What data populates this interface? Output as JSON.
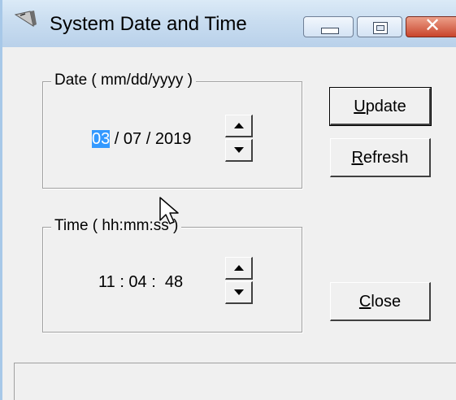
{
  "window": {
    "title": "System Date and Time",
    "app_icon": "app-icon",
    "controls": {
      "minimize": "minimize-icon",
      "maximize": "maximize-icon",
      "close": "close-icon"
    }
  },
  "date_group": {
    "legend": "Date ( mm/dd/yyyy )",
    "month": "03",
    "sep1": " / ",
    "day": "07",
    "sep2": " / ",
    "year": "2019",
    "selected_segment": "month"
  },
  "time_group": {
    "legend": "Time ( hh:mm:ss )",
    "value": "11 : 04 :  48"
  },
  "buttons": {
    "update": {
      "mnemonic": "U",
      "rest": "pdate"
    },
    "refresh": {
      "mnemonic": "R",
      "rest": "efresh"
    },
    "close": {
      "mnemonic": "C",
      "rest": "lose"
    }
  },
  "status_bar": {
    "text": ""
  },
  "colors": {
    "selection": "#3399ff",
    "dialog_bg": "#f0f0f0",
    "close_button": "#c9452c",
    "titlebar": "#c9ddf0"
  }
}
